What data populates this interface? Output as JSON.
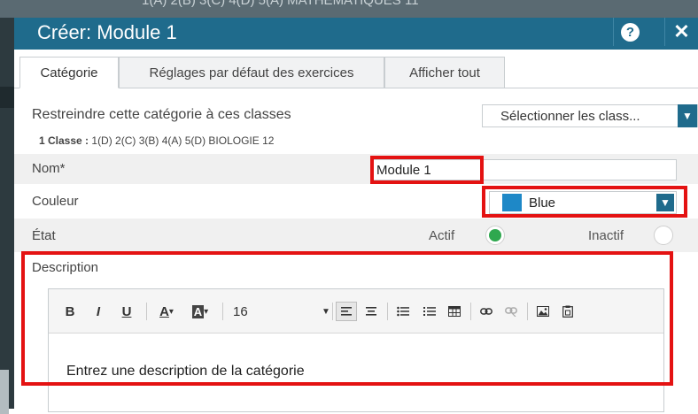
{
  "window": {
    "title": "Créer: Module 1",
    "help_icon": "question-circle-icon",
    "close_icon": "close-icon"
  },
  "tabs": [
    {
      "label": "Catégorie",
      "active": true
    },
    {
      "label": "Réglages par défaut des exercices",
      "active": false
    },
    {
      "label": "Afficher tout",
      "active": false
    }
  ],
  "restrict": {
    "label": "Restreindre cette catégorie à ces classes",
    "select_value": "Sélectionner les class...",
    "classes_prefix": "1 Classe :",
    "classes_list": "1(D) 2(C) 3(B) 4(A) 5(D) BIOLOGIE 12"
  },
  "name": {
    "label": "Nom*",
    "value": "Module 1"
  },
  "color": {
    "label": "Couleur",
    "value": "Blue",
    "swatch": "#1e88c7"
  },
  "state": {
    "label": "État",
    "active_label": "Actif",
    "inactive_label": "Inactif",
    "selected": "Actif"
  },
  "description": {
    "label": "Description",
    "font_size": "16",
    "placeholder": "Entrez une description de la catégorie"
  },
  "toolbar": {
    "bold": "B",
    "italic": "I",
    "underline": "U",
    "font_color": "A",
    "bg_color": "A",
    "dropdown": "▾",
    "icons": [
      "bold-icon",
      "italic-icon",
      "underline-icon",
      "font-color-icon",
      "background-color-icon",
      "font-size-select",
      "align-left-icon",
      "align-center-icon",
      "bullet-list-icon",
      "numbered-list-icon",
      "table-icon",
      "link-icon",
      "unlink-icon",
      "image-icon",
      "paste-icon"
    ]
  },
  "colors": {
    "titlebar": "#1f6b8c",
    "accent": "#1f6b8c",
    "highlight": "#e41212",
    "radio_on": "#2fa84f"
  }
}
